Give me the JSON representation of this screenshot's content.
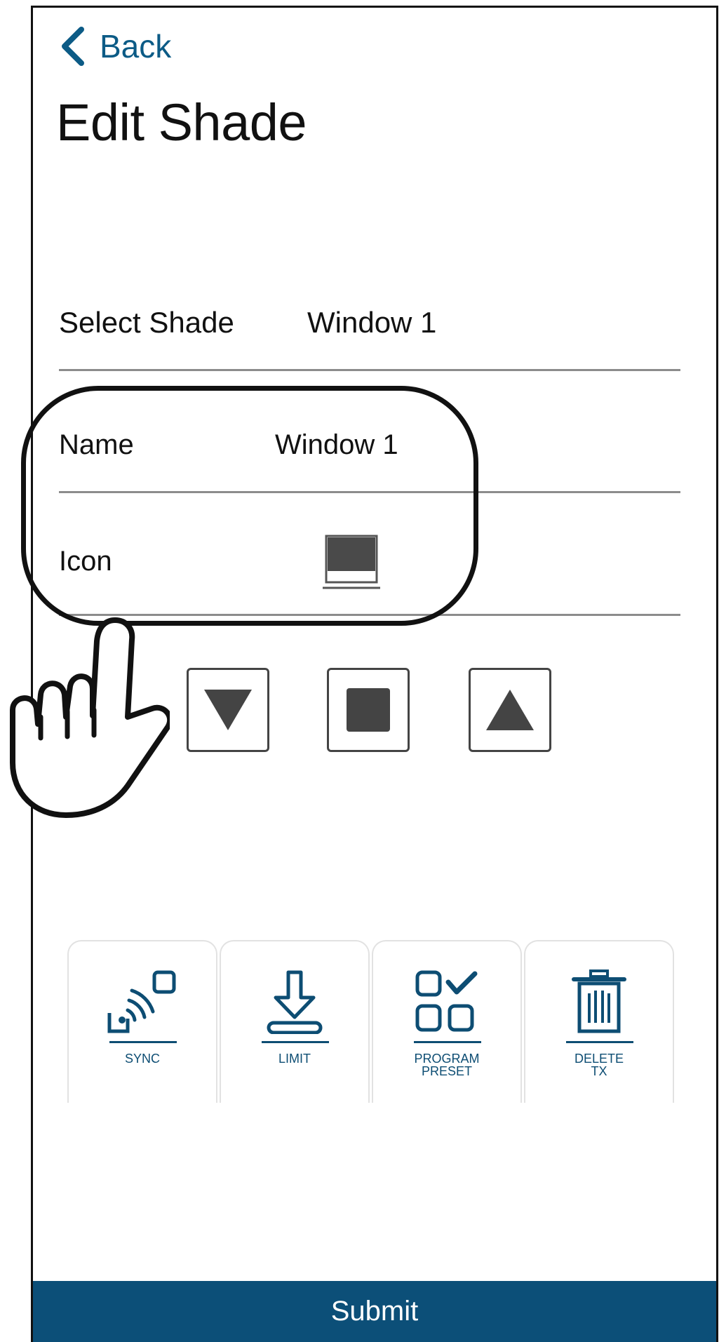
{
  "header": {
    "back_label": "Back",
    "title": "Edit Shade"
  },
  "form": {
    "select_shade": {
      "label": "Select Shade",
      "value": "Window 1"
    },
    "name": {
      "label": "Name",
      "value": "Window 1"
    },
    "icon": {
      "label": "Icon",
      "icon_name": "window-shade-icon"
    }
  },
  "controls": [
    {
      "name": "down-button",
      "icon": "triangle-down-icon"
    },
    {
      "name": "stop-button",
      "icon": "square-stop-icon"
    },
    {
      "name": "up-button",
      "icon": "triangle-up-icon"
    }
  ],
  "actions": [
    {
      "label": "SYNC",
      "icon": "sync-icon"
    },
    {
      "label": "LIMIT",
      "icon": "limit-icon"
    },
    {
      "label": "PROGRAM\nPRESET",
      "icon": "program-preset-icon"
    },
    {
      "label": "DELETE\nTX",
      "icon": "trash-icon"
    }
  ],
  "submit_label": "Submit",
  "colors": {
    "brand_blue": "#0c4f78",
    "accent_blue": "#0c5b86",
    "icon_blue": "#0d4d73",
    "control_fill": "#444444"
  }
}
